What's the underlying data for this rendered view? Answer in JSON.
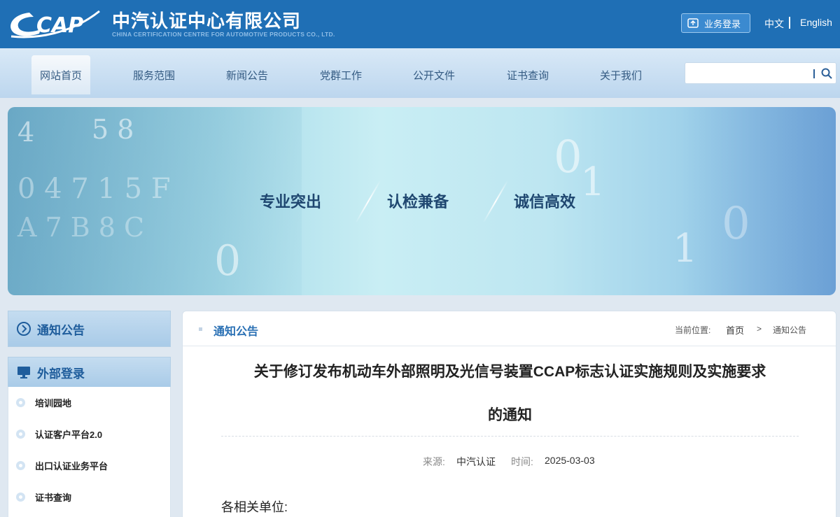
{
  "header": {
    "company_cn": "中汽认证中心有限公司",
    "company_en": "CHINA CERTIFICATION CENTRE FOR AUTOMOTIVE PRODUCTS CO., LTD.",
    "login_label": "业务登录",
    "lang_cn": "中文",
    "lang_en": "English"
  },
  "nav": {
    "items": [
      {
        "label": "网站首页"
      },
      {
        "label": "服务范围"
      },
      {
        "label": "新闻公告"
      },
      {
        "label": "党群工作"
      },
      {
        "label": "公开文件"
      },
      {
        "label": "证书查询"
      },
      {
        "label": "关于我们"
      }
    ],
    "search_placeholder": ""
  },
  "banner": {
    "slogans": [
      "专业突出",
      "认检兼备",
      "诚信高效"
    ]
  },
  "sidebar": {
    "notice_title": "通知公告",
    "external_title": "外部登录",
    "links": [
      {
        "label": "培训园地"
      },
      {
        "label": "认证客户平台2.0"
      },
      {
        "label": "出口认证业务平台"
      },
      {
        "label": "证书查询"
      }
    ]
  },
  "main": {
    "section_title": "通知公告",
    "breadcrumb_prefix": "当前位置:",
    "breadcrumb_home": "首页",
    "breadcrumb_sep": ">",
    "breadcrumb_current": "通知公告",
    "article_title_line1": "关于修订发布机动车外部照明及光信号装置CCAP标志认证实施规则及实施要求",
    "article_title_line2": "的通知",
    "source_label": "来源:",
    "source_value": "中汽认证",
    "time_label": "时间:",
    "time_value": "2025-03-03",
    "salutation": "各相关单位:"
  },
  "colors": {
    "header_bg": "#1f6fb5",
    "accent": "#2a70b4"
  }
}
